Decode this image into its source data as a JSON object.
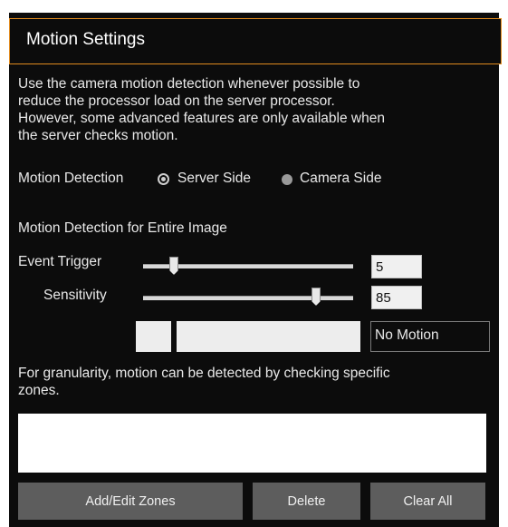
{
  "header": {
    "title": "Motion Settings"
  },
  "description": "Use the camera motion detection whenever possible to\nreduce the processor load on the server processor.\nHowever, some advanced features are only available when\nthe server checks motion.",
  "motion_detection": {
    "label": "Motion Detection",
    "options": [
      {
        "label": "Server Side",
        "selected": true
      },
      {
        "label": "Camera Side",
        "selected": false
      }
    ]
  },
  "entire_image": {
    "heading": "Motion Detection for Entire Image",
    "event_trigger": {
      "label": "Event Trigger",
      "value": "5"
    },
    "sensitivity": {
      "label": "Sensitivity",
      "value": "85"
    },
    "status": "No Motion"
  },
  "zones": {
    "description": "For granularity, motion can be detected by checking specific\nzones."
  },
  "buttons": {
    "add_edit": "Add/Edit Zones",
    "delete": "Delete",
    "clear_all": "Clear All"
  },
  "colors": {
    "accent_border": "#e08a1e",
    "panel_bg": "#0c0c0c",
    "button_bg": "#5d5d5d"
  }
}
